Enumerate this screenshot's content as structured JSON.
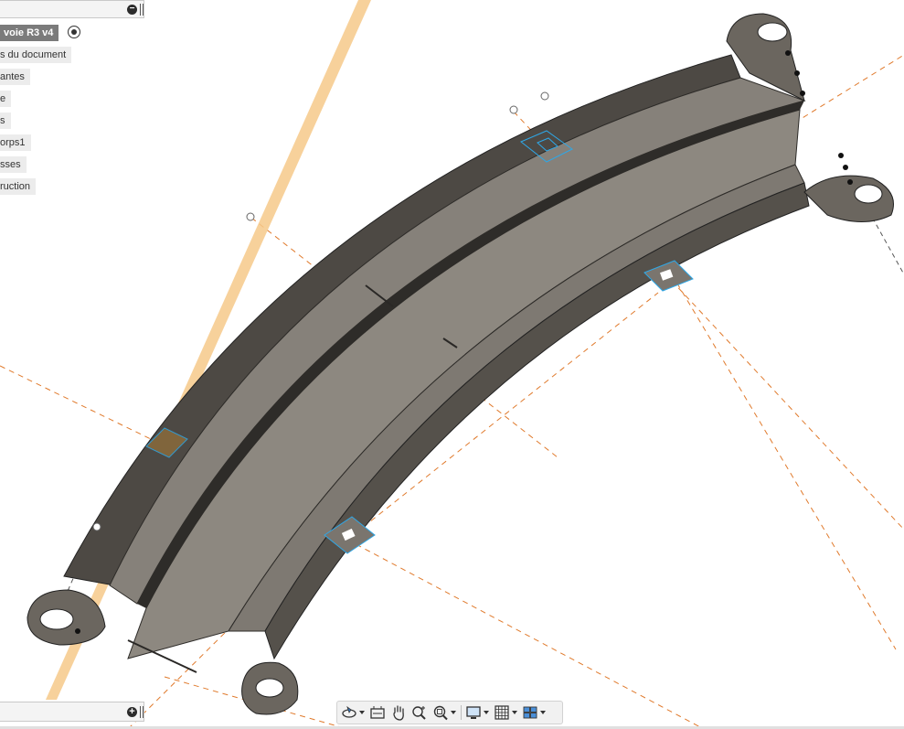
{
  "browser": {
    "items": [
      {
        "label": " voie R3 v4"
      },
      {
        "label": "s du document"
      },
      {
        "label": "antes"
      },
      {
        "label": "e"
      },
      {
        "label": "s"
      },
      {
        "label": "orps1"
      },
      {
        "label": "sses"
      },
      {
        "label": "ruction"
      }
    ]
  },
  "comments": {},
  "toolbar": {
    "buttons": [
      {
        "icon": "orbit-icon",
        "has_menu": true
      },
      {
        "icon": "look-at-icon",
        "has_menu": false
      },
      {
        "icon": "pan-hand-icon",
        "has_menu": false
      },
      {
        "icon": "zoom-icon",
        "has_menu": false
      },
      {
        "icon": "fit-window-icon",
        "has_menu": true
      },
      {
        "icon": "display-settings-icon",
        "has_menu": true
      },
      {
        "icon": "grid-icon",
        "has_menu": true
      },
      {
        "icon": "viewports-icon",
        "has_menu": true
      }
    ]
  },
  "colors": {
    "body": "#6b665f",
    "body_top": "#8c877f",
    "plane": "#f6c98a",
    "construction": "#e07a2c",
    "selection": "#2fa7e6"
  }
}
